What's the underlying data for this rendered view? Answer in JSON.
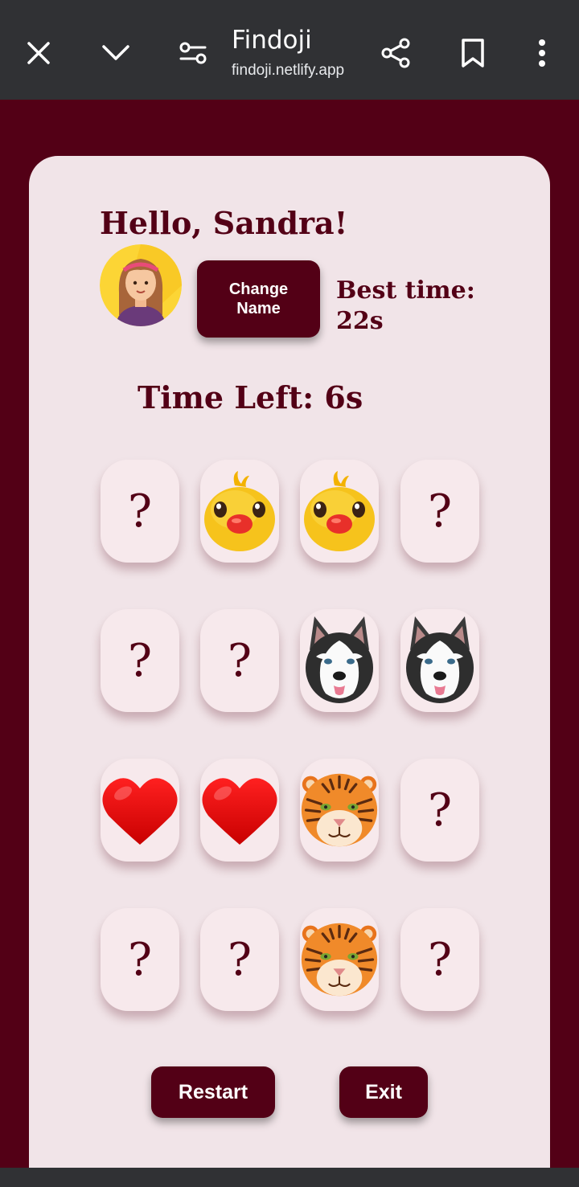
{
  "browser": {
    "title": "Findoji",
    "url": "findoji.netlify.app",
    "icons": [
      "close-icon",
      "chevron-down-icon",
      "site-settings-icon",
      "share-icon",
      "bookmark-icon",
      "more-vert-icon"
    ]
  },
  "greeting": "Hello, Sandra!",
  "change_name_label": "Change Name",
  "best_time_label": "Best time:",
  "best_time_value": "22s",
  "time_left": "Time Left: 6s",
  "hidden_symbol": "?",
  "grid": [
    [
      "hidden",
      "chick",
      "chick",
      "hidden"
    ],
    [
      "hidden",
      "hidden",
      "husky",
      "husky"
    ],
    [
      "heart",
      "heart",
      "tiger",
      "hidden"
    ],
    [
      "hidden",
      "hidden",
      "tiger",
      "hidden"
    ]
  ],
  "restart_label": "Restart",
  "exit_label": "Exit",
  "colors": {
    "brand": "#530016",
    "card": "#f1e4e8",
    "tile": "#f7e9ec",
    "toolbar": "#303134"
  }
}
